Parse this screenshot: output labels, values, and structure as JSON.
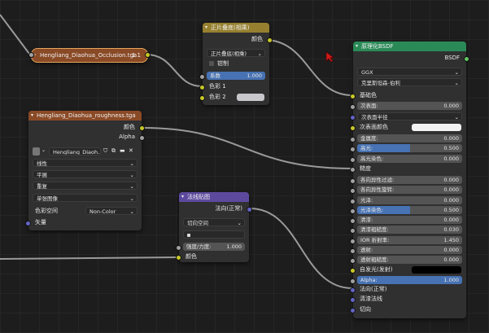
{
  "nodes": {
    "occlusion": {
      "title": "Hengliang_Diaohua_Occlusion.tga",
      "extra": "1 1"
    },
    "multiply": {
      "title": "正片叠底(相乘)",
      "output_color": "颜色",
      "blend_mode": "正片叠底(相乘)",
      "clamp_label": "钳制",
      "factor_label": "系数",
      "factor_value": "1.000",
      "color1": "色彩 1",
      "color2": "色彩 2"
    },
    "roughness": {
      "title": "Hengliang_Diaohua_roughness.tga",
      "output_color": "颜色",
      "output_alpha": "Alpha",
      "image_name": "Hengliang_Diaoh...",
      "interpolation": "线性",
      "projection": "平展",
      "extension": "重复",
      "source": "单张图像",
      "color_space_label": "色彩空间",
      "color_space": "Non-Color",
      "vector": "矢量"
    },
    "normal_map": {
      "title": "法线贴图",
      "output_normal": "法向(正常)",
      "space": "切向空间",
      "uvmap": "",
      "strength_label": "强度/力度:",
      "strength_value": "1.000",
      "color": "颜色"
    },
    "bsdf": {
      "title": "原理化BSDF",
      "output": "BSDF",
      "distribution": "GGX",
      "subsurface_method": "克里斯坦森-伯利",
      "base_color": "基础色",
      "subsurface_label": "次表面:",
      "subsurface_value": "0.000",
      "subsurface_radius": "次表面半径",
      "subsurface_color": "次表面颜色",
      "metallic_label": "金属度:",
      "metallic_value": "0.000",
      "specular_label": "高光:",
      "specular_value": "0.500",
      "specular_fill": 0.5,
      "specular_tint_label": "高光染色:",
      "specular_tint_value": "0.000",
      "roughness": "糙度",
      "anisotropic_label": "各向异性过滤:",
      "anisotropic_value": "0.000",
      "aniso_rotation_label": "各向异性旋转:",
      "aniso_rotation_value": "0.000",
      "sheen_label": "光泽:",
      "sheen_value": "0.000",
      "sheen_tint_label": "光泽染色:",
      "sheen_tint_value": "0.500",
      "sheen_tint_fill": 0.5,
      "clearcoat_label": "清漆:",
      "clearcoat_value": "0.000",
      "clearcoat_rough_label": "清漆粗糙度:",
      "clearcoat_rough_value": "0.030",
      "ior_label": "IOR 折射率:",
      "ior_value": "1.450",
      "transmission_label": "透射:",
      "transmission_value": "0.000",
      "transmission_rough_label": "透射粗糙度:",
      "transmission_rough_value": "0.000",
      "emission": "自发光(发射)",
      "alpha_label": "Alpha:",
      "alpha_value": "1.000",
      "alpha_fill": 1.0,
      "normal": "法向(正常)",
      "clearcoat_normal": "清漆法线",
      "tangent": "切向"
    }
  },
  "colors": {
    "image_header": "#8a4a26",
    "color_header": "#96802f",
    "vector_header": "#5d4a9e",
    "shader_header": "#2a8a57",
    "selected": "#e6a55c",
    "slider_fill": "#4772b3"
  }
}
